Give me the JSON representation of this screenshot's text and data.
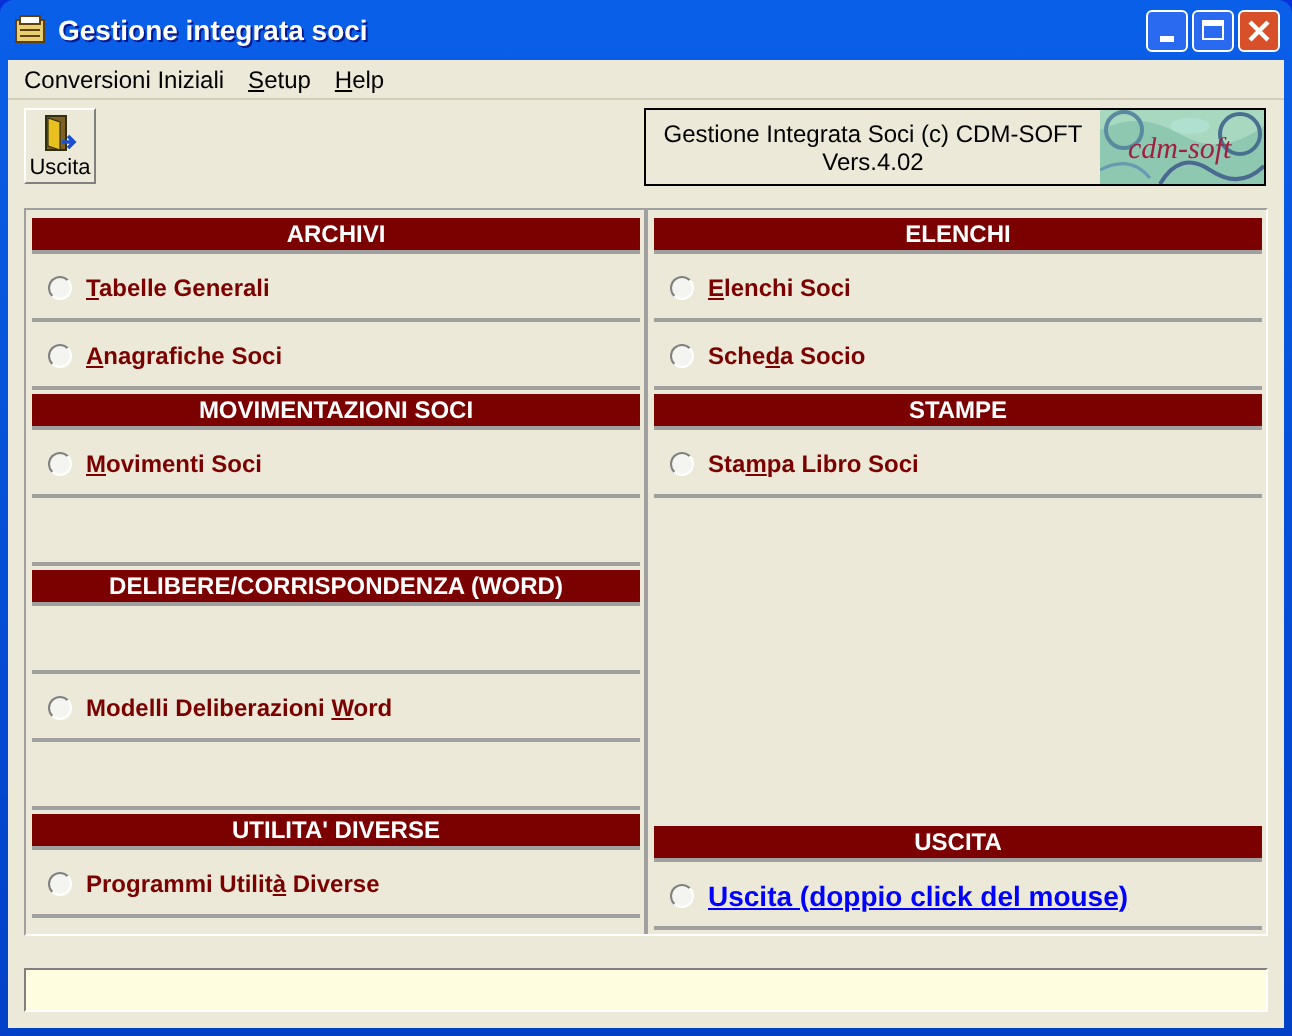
{
  "window": {
    "title": "Gestione integrata soci"
  },
  "menu": [
    {
      "pre": "Conversioni Iniziali"
    },
    {
      "key": "S",
      "post": "etup"
    },
    {
      "key": "H",
      "post": "elp"
    }
  ],
  "toolbar": {
    "exit_button": "Uscita"
  },
  "banner": {
    "lines": [
      "Gestione Integrata Soci (c) CDM-SOFT",
      "Vers.4.02"
    ],
    "logo": "cdm-soft"
  },
  "columns": [
    {
      "sections": [
        {
          "title": "ARCHIVI",
          "rows": [
            {
              "kind": "option",
              "selected": false,
              "key": "T",
              "post": "abelle Generali"
            },
            {
              "kind": "option",
              "selected": false,
              "key": "A",
              "post": "nagrafiche Soci"
            }
          ]
        },
        {
          "title": "MOVIMENTAZIONI SOCI",
          "rows": [
            {
              "kind": "option",
              "selected": false,
              "key": "M",
              "post": "ovimenti Soci"
            },
            {
              "kind": "blank"
            }
          ]
        },
        {
          "title": "DELIBERE/CORRISPONDENZA (WORD)",
          "rows": [
            {
              "kind": "blank"
            },
            {
              "kind": "option",
              "selected": false,
              "pre": "Modelli Deliberazioni ",
              "key": "W",
              "post": "ord"
            },
            {
              "kind": "blank"
            }
          ]
        },
        {
          "title": "UTILITA' DIVERSE",
          "rows": [
            {
              "kind": "option",
              "selected": false,
              "pre": "Programmi Utilit",
              "key": "à",
              "post": " Diverse"
            }
          ]
        }
      ]
    },
    {
      "sections": [
        {
          "title": "ELENCHI",
          "rows": [
            {
              "kind": "option",
              "selected": false,
              "key": "E",
              "post": "lenchi Soci"
            },
            {
              "kind": "option",
              "selected": false,
              "pre": "Sche",
              "key": "d",
              "post": "a Socio"
            }
          ]
        },
        {
          "title": "STAMPE",
          "rows": [
            {
              "kind": "option",
              "selected": false,
              "pre": "Sta",
              "key": "m",
              "post": "pa Libro Soci"
            }
          ]
        },
        {
          "kind": "spacer"
        },
        {
          "title": "USCITA",
          "rows": [
            {
              "kind": "link",
              "selected": false,
              "pre": "Uscita (doppio click del mouse)"
            }
          ]
        }
      ]
    }
  ]
}
